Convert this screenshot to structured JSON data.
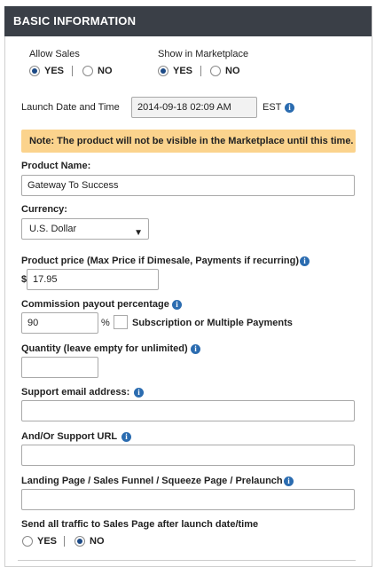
{
  "header": {
    "title": "BASIC INFORMATION"
  },
  "allow_sales": {
    "label": "Allow Sales",
    "yes": "YES",
    "no": "NO",
    "selected": "yes"
  },
  "show_marketplace": {
    "label": "Show in Marketplace",
    "yes": "YES",
    "no": "NO",
    "selected": "yes"
  },
  "launch": {
    "label": "Launch Date and Time",
    "value": "2014-09-18 02:09 AM",
    "tz": "EST"
  },
  "note": "Note: The product will not be visible in the Marketplace until this time.",
  "product_name": {
    "label": "Product Name:",
    "value": "Gateway To Success"
  },
  "currency": {
    "label": "Currency:",
    "value": "U.S. Dollar"
  },
  "price": {
    "label": "Product price (Max Price if Dimesale, Payments if recurring)",
    "prefix": "$",
    "value": "17.95"
  },
  "commission": {
    "label": "Commission payout percentage",
    "value": "90",
    "suffix": "%",
    "checkbox_label": "Subscription or Multiple Payments"
  },
  "quantity": {
    "label": "Quantity (leave empty for unlimited)",
    "value": ""
  },
  "support_email": {
    "label": "Support email address:",
    "value": ""
  },
  "support_url": {
    "label": "And/Or Support URL",
    "value": ""
  },
  "landing_page": {
    "label": "Landing Page / Sales Funnel / Squeeze Page / Prelaunch",
    "value": ""
  },
  "send_traffic": {
    "label": "Send all traffic to Sales Page after launch date/time",
    "yes": "YES",
    "no": "NO",
    "selected": "no"
  },
  "icons": {
    "info": "info-icon",
    "dropdown": "caret-down-icon"
  },
  "colors": {
    "header_bg": "#3a3f47",
    "note_bg": "#fbd38d",
    "info_blue": "#2b6cb0",
    "radio_selected": "#1c4a86"
  }
}
